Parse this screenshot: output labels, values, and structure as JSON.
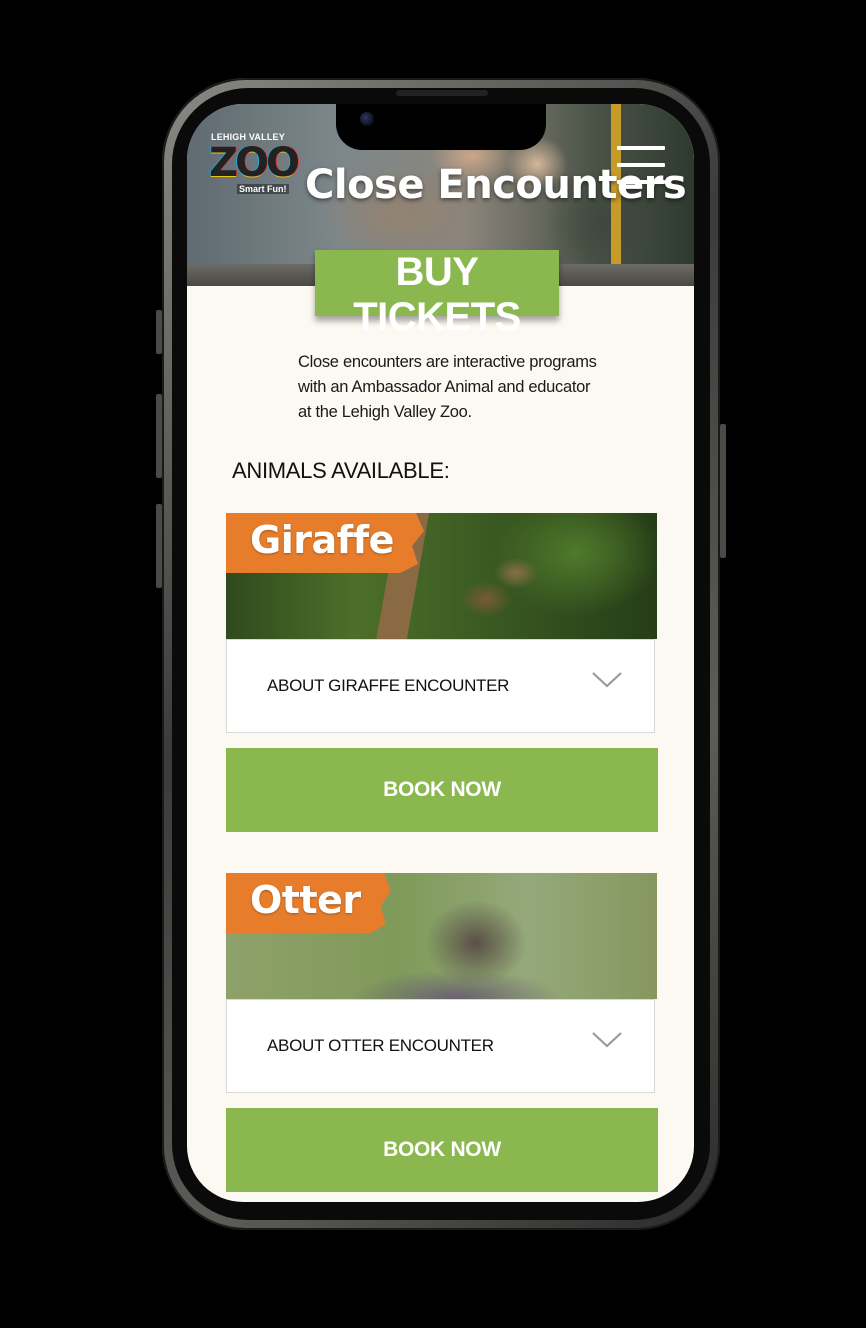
{
  "header": {
    "logo": {
      "line1": "LEHIGH VALLEY",
      "name": "ZOO",
      "tagline": "Smart Fun!"
    },
    "title": "Close Encounters",
    "menu_icon": "hamburger-menu-icon"
  },
  "buy_tickets_label": "BUY TICKETS",
  "intro_text": "Close encounters are interactive programs with an Ambassador Animal and educator at the Lehigh Valley Zoo.",
  "animals_heading": "ANIMALS AVAILABLE:",
  "animals": [
    {
      "name": "Giraffe",
      "about_label": "ABOUT GIRAFFE ENCOUNTER",
      "book_label": "BOOK NOW"
    },
    {
      "name": "Otter",
      "about_label": "ABOUT OTTER ENCOUNTER",
      "book_label": "BOOK NOW"
    }
  ],
  "colors": {
    "accent_green": "#8ab84f",
    "label_orange": "#e77d2b",
    "page_bg": "#fcf9f2"
  }
}
